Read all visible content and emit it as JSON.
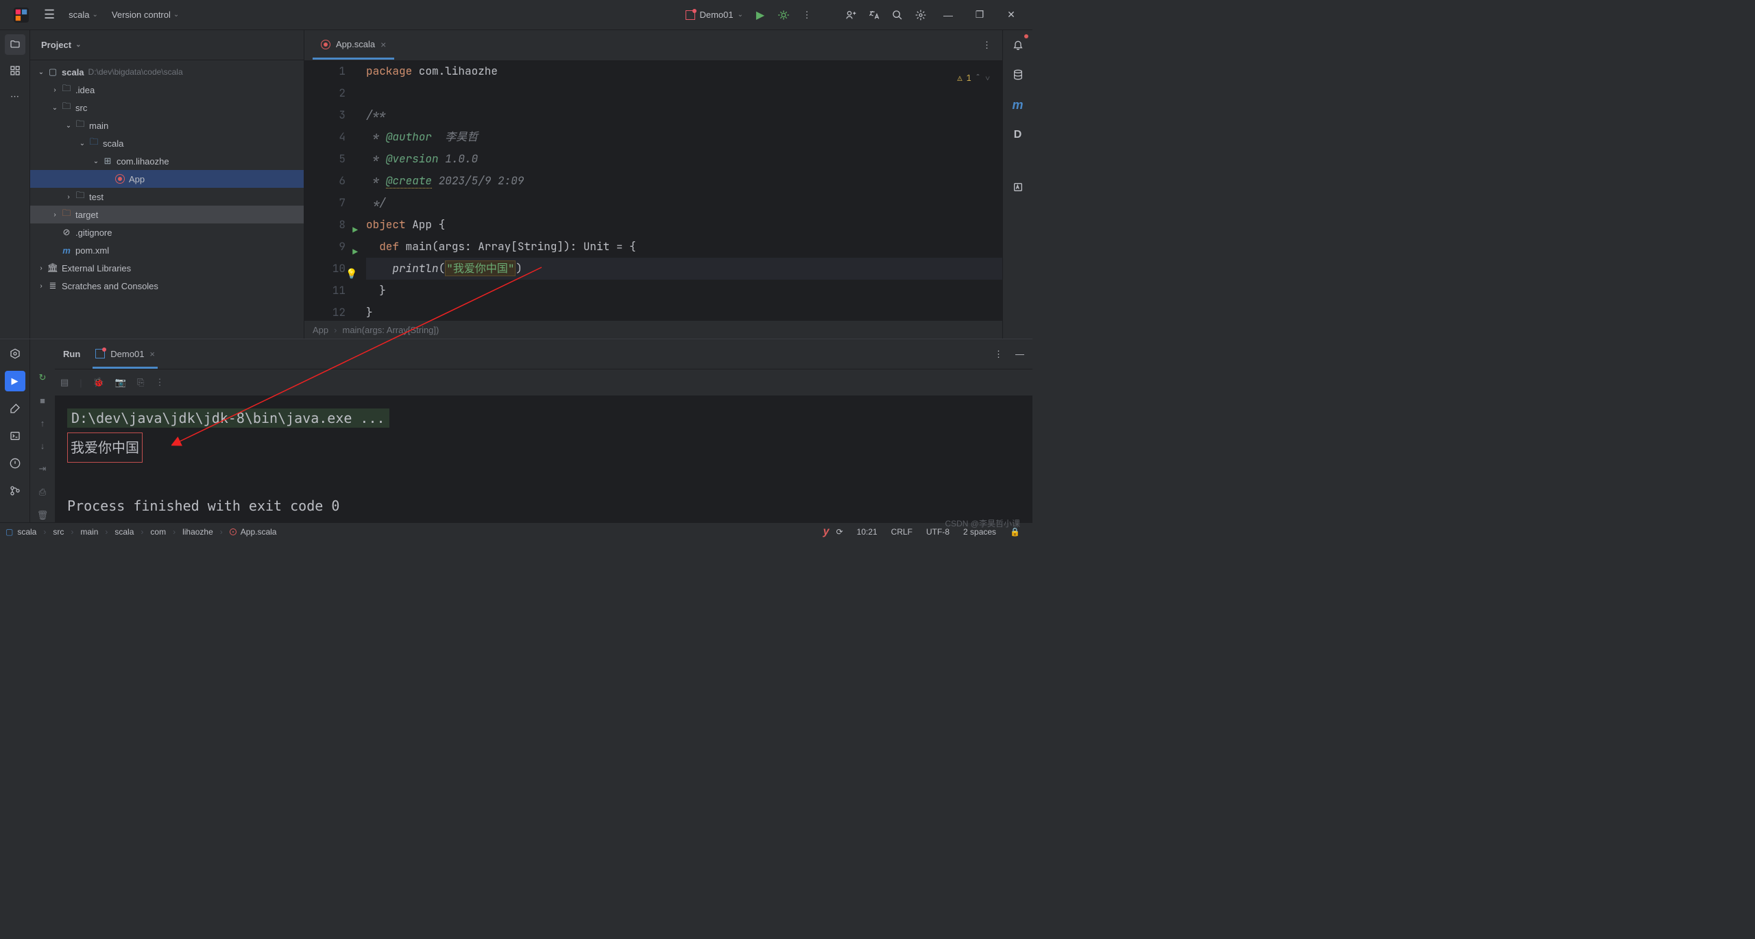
{
  "titlebar": {
    "project": "scala",
    "vcs": "Version control",
    "run_config": "Demo01"
  },
  "project_panel": {
    "title": "Project",
    "root": {
      "name": "scala",
      "path": "D:\\dev\\bigdata\\code\\scala"
    },
    "nodes": {
      "idea": ".idea",
      "src": "src",
      "main": "main",
      "scala_src": "scala",
      "pkg": "com.lihaozhe",
      "app": "App",
      "test": "test",
      "target": "target",
      "gitignore": ".gitignore",
      "pom": "pom.xml",
      "ext_lib": "External Libraries",
      "scratches": "Scratches and Consoles"
    }
  },
  "editor": {
    "tab": "App.scala",
    "warnings": "1",
    "lines": {
      "1": {
        "pkg": "package",
        "name": " com.lihaozhe"
      },
      "3": "/**",
      "4": {
        "tag": "@author",
        "val": "李昊哲"
      },
      "5": {
        "tag": "@version",
        "val": "1.0.0"
      },
      "6": {
        "tag": "@create",
        "val": "2023/5/9 2:09"
      },
      "7": " */",
      "8": {
        "kw1": "object",
        "name": " App {"
      },
      "9": {
        "kw1": "def",
        "fn": " main",
        "sig": "(args: Array[String]): Unit = {"
      },
      "10": {
        "fn": "println",
        "str": "\"我爱你中国\""
      },
      "11": "  }",
      "12": "}"
    },
    "breadcrumb": {
      "a": "App",
      "b": "main(args: Array[String])"
    }
  },
  "run": {
    "title": "Run",
    "tab": "Demo01",
    "cmd": "D:\\dev\\java\\jdk\\jdk-8\\bin\\java.exe ...",
    "output": "我爱你中国",
    "exit": "Process finished with exit code 0"
  },
  "statusbar": {
    "crumbs": [
      "scala",
      "src",
      "main",
      "scala",
      "com",
      "lihaozhe",
      "App.scala"
    ],
    "time": "10:21",
    "eol": "CRLF",
    "encoding": "UTF-8",
    "indent": "2 spaces"
  },
  "watermark": "CSDN @李昊哲小课"
}
